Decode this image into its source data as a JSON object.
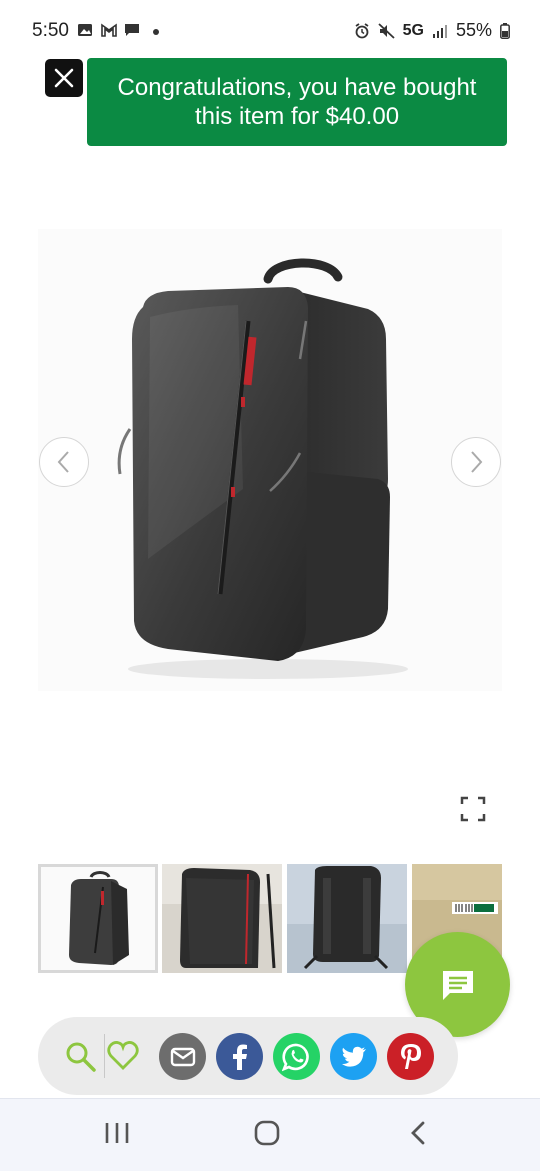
{
  "status_bar": {
    "time": "5:50",
    "network": "5G",
    "battery": "55%"
  },
  "toast": {
    "message": "Congratulations, you have bought this item for $40.00",
    "close_icon": "close-icon"
  },
  "product": {
    "image": "black-backpack",
    "thumbnails": [
      "backpack-front",
      "backpack-side",
      "backpack-back",
      "box-package"
    ]
  },
  "share": {
    "items": [
      "search-icon",
      "heart-icon",
      "email-icon",
      "facebook-icon",
      "whatsapp-icon",
      "twitter-icon",
      "pinterest-icon"
    ],
    "colors": {
      "email": "#6d6d6d",
      "facebook": "#3b5998",
      "whatsapp": "#25d366",
      "twitter": "#1da1f2",
      "pinterest": "#cb2027",
      "accent": "#8dc63f"
    }
  },
  "chat": {
    "icon": "chat-icon"
  },
  "toast_color": "#0b8a43"
}
